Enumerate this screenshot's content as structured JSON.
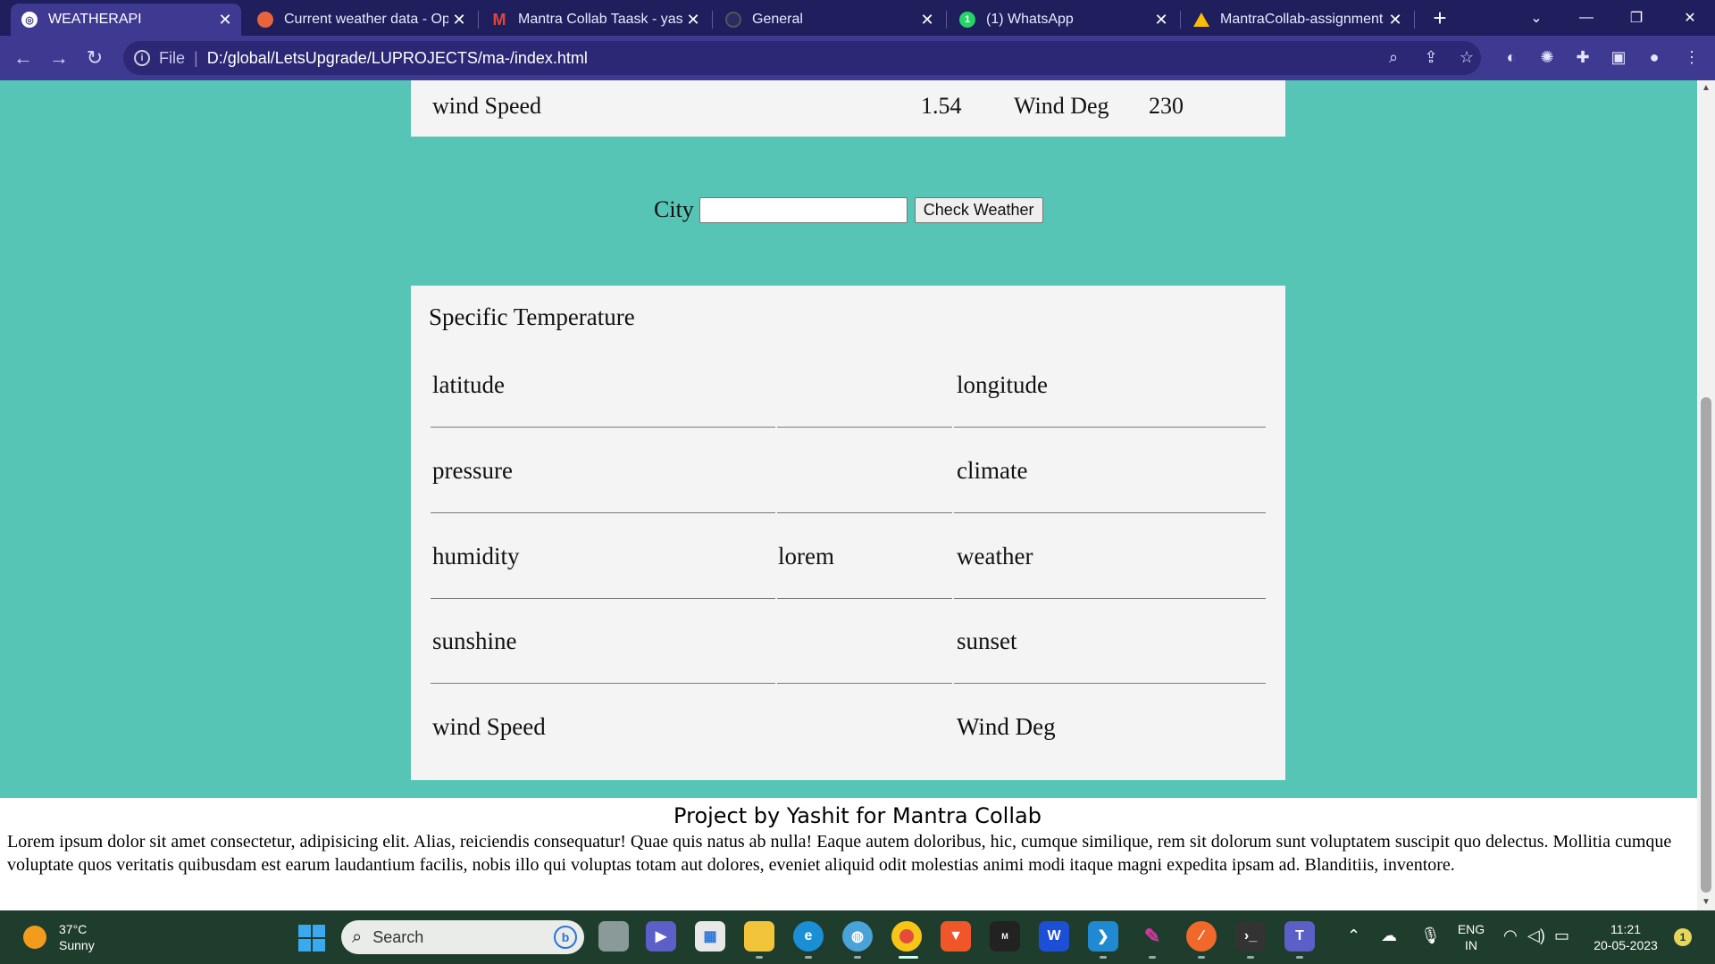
{
  "browser": {
    "tabs": [
      {
        "label": "WEATHERAPI",
        "active": true,
        "icon": "globe-icon"
      },
      {
        "label": "Current weather data - Ope",
        "active": false,
        "icon": "openweather-icon"
      },
      {
        "label": "Mantra Collab Taask - yashi",
        "active": false,
        "icon": "gmail-icon"
      },
      {
        "label": "General",
        "active": false,
        "icon": "github-icon"
      },
      {
        "label": "(1) WhatsApp",
        "active": false,
        "icon": "whatsapp-icon",
        "badge": "1"
      },
      {
        "label": "MantraCollab-assignment -",
        "active": false,
        "icon": "drive-icon"
      }
    ],
    "close_glyph": "✕",
    "new_tab_glyph": "+",
    "scheme_label": "File",
    "url": "D:/global/LetsUpgrade/LUPROJECTS/ma-/index.html"
  },
  "weather_top": {
    "label1": "wind Speed",
    "value1": "1.54",
    "label2": "Wind Deg",
    "value2": "230"
  },
  "search": {
    "city_label": "City",
    "city_value": "",
    "button_label": "Check Weather"
  },
  "specific": {
    "title": "Specific Temperature",
    "rows": [
      {
        "label1": "latitude",
        "value": "",
        "label2": "longitude"
      },
      {
        "label1": "pressure",
        "value": "",
        "label2": "climate"
      },
      {
        "label1": "humidity",
        "value": "lorem",
        "label2": "weather"
      },
      {
        "label1": "sunshine",
        "value": "",
        "label2": "sunset"
      },
      {
        "label1": "wind Speed",
        "value": "",
        "label2": "Wind Deg"
      }
    ]
  },
  "footer": {
    "title": "Project by Yashit for Mantra Collab",
    "text": "Lorem ipsum dolor sit amet consectetur, adipisicing elit. Alias, reiciendis consequatur! Quae quis natus ab nulla! Eaque autem doloribus, hic, cumque similique, rem sit dolorum sunt voluptatem suscipit quo delectus. Mollitia cumque voluptate quos veritatis quibusdam est earum laudantium facilis, nobis illo qui voluptas totam aut dolores, eveniet aliquid odit molestias animi modi itaque magni expedita ipsam ad. Blanditiis, inventore."
  },
  "taskbar": {
    "weather_temp": "37°C",
    "weather_desc": "Sunny",
    "search_placeholder": "Search",
    "lang_line1": "ENG",
    "lang_line2": "IN",
    "time": "11:21",
    "date": "20-05-2023",
    "notification_count": "1"
  },
  "colors": {
    "page_bg": "#56c5b5",
    "card_bg": "#f4f4f4",
    "tabstrip_bg": "#1e1f5c",
    "toolbar_bg": "#3f3a91",
    "taskbar_bg": "#1f3d2c"
  }
}
